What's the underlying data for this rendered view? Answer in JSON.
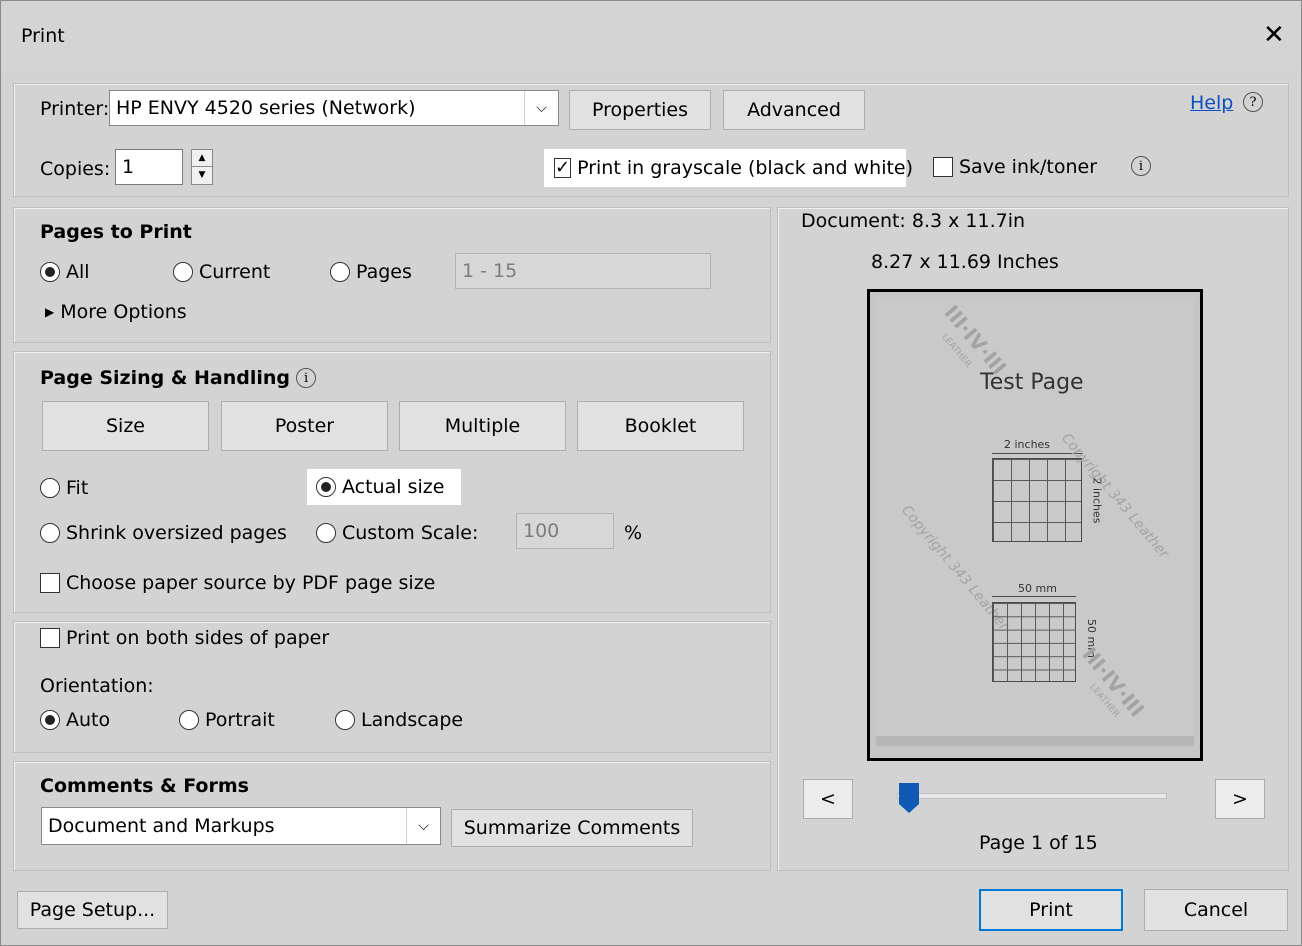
{
  "window": {
    "title": "Print"
  },
  "printer": {
    "label": "Printer:",
    "selected": "HP ENVY 4520 series (Network)",
    "properties_label": "Properties",
    "advanced_label": "Advanced",
    "help_label": "Help"
  },
  "copies": {
    "label": "Copies:",
    "value": "1"
  },
  "options": {
    "grayscale_label": "Print in grayscale (black and white)",
    "grayscale_checked": true,
    "save_ink_label": "Save ink/toner",
    "save_ink_checked": false
  },
  "pages_to_print": {
    "heading": "Pages to Print",
    "all_label": "All",
    "current_label": "Current",
    "pages_label": "Pages",
    "pages_range": "1 - 15",
    "more_options_label": "More Options"
  },
  "sizing": {
    "heading": "Page Sizing & Handling",
    "tabs": [
      "Size",
      "Poster",
      "Multiple",
      "Booklet"
    ],
    "fit_label": "Fit",
    "actual_size_label": "Actual size",
    "shrink_label": "Shrink oversized pages",
    "custom_scale_label": "Custom Scale:",
    "custom_scale_value": "100",
    "percent": "%",
    "paper_source_label": "Choose paper source by PDF page size"
  },
  "duplex": {
    "both_sides_label": "Print on both sides of paper",
    "orientation_label": "Orientation:",
    "auto_label": "Auto",
    "portrait_label": "Portrait",
    "landscape_label": "Landscape"
  },
  "comments": {
    "heading": "Comments & Forms",
    "selected": "Document and Markups",
    "summarize_label": "Summarize Comments"
  },
  "preview": {
    "document_size": "Document: 8.3 x 11.7in",
    "paper_size": "8.27 x 11.69 Inches",
    "page_title": "Test Page",
    "label_2in_top": "2 inches",
    "label_2in_side": "2 inches",
    "label_50mm_top": "50 mm",
    "label_50mm_side": "50 mm",
    "watermark_1": "Copyright 343 Leather",
    "watermark_2": "Copyright 343 Leather",
    "logo_1": "III·IV·III",
    "logo_2": "III·IV·III",
    "logo_sub_1": "LEATHER",
    "logo_sub_2": "LEATHER",
    "prev_label": "<",
    "next_label": ">",
    "page_indicator": "Page 1 of 15",
    "slider_position": 0
  },
  "footer": {
    "page_setup_label": "Page Setup...",
    "print_label": "Print",
    "cancel_label": "Cancel"
  }
}
